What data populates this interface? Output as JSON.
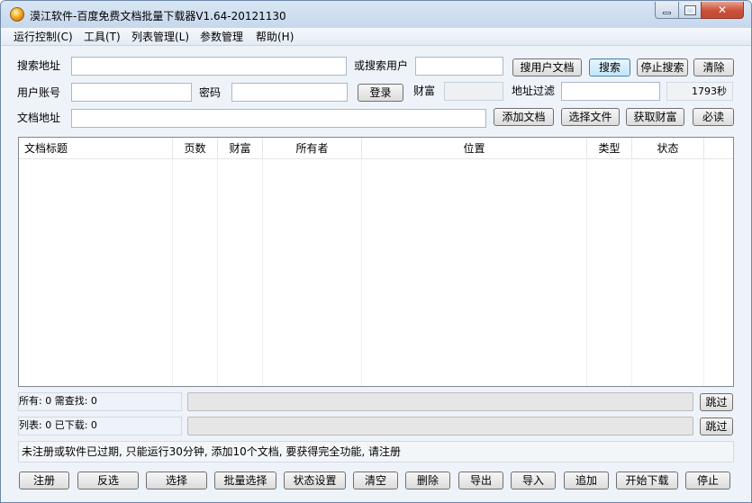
{
  "window": {
    "title": "漠江软件-百度免费文档批量下载器V1.64-20121130"
  },
  "menu": [
    "运行控制(C)",
    "工具(T)",
    "列表管理(L)",
    "参数管理",
    "帮助(H)"
  ],
  "search": {
    "address_label": "搜索地址",
    "address_value": "",
    "or_user_label": "或搜索用户",
    "user_value": "",
    "search_user_docs_button": "搜用户文档",
    "search_button": "搜索",
    "stop_search_button": "停止搜索",
    "clear_button": "清除"
  },
  "account": {
    "user_label": "用户账号",
    "user_value": "",
    "password_label": "密码",
    "password_value": "",
    "login_button": "登录",
    "wealth_label": "财富",
    "wealth_value": "",
    "filter_label": "地址过滤",
    "filter_value": "",
    "remaining_time": "1793秒"
  },
  "document": {
    "address_label": "文档地址",
    "address_value": "",
    "add_button": "添加文档",
    "choose_file_button": "选择文件",
    "get_wealth_button": "获取财富",
    "must_read_button": "必读"
  },
  "table": {
    "columns": [
      "文档标题",
      "页数",
      "财富",
      "所有者",
      "位置",
      "类型",
      "状态"
    ],
    "rows": []
  },
  "status": {
    "total_line": "所有: 0  需查找: 0",
    "list_line": "列表: 0  已下载: 0",
    "skip_button_1": "跳过",
    "skip_button_2": "跳过",
    "notice": "未注册或软件已过期, 只能运行30分钟, 添加10个文档, 要获得完全功能, 请注册"
  },
  "bottom_buttons": [
    "注册",
    "反选",
    "选择",
    "批量选择",
    "状态设置",
    "清空",
    "删除",
    "导出",
    "导入",
    "追加",
    "开始下载",
    "停止"
  ]
}
